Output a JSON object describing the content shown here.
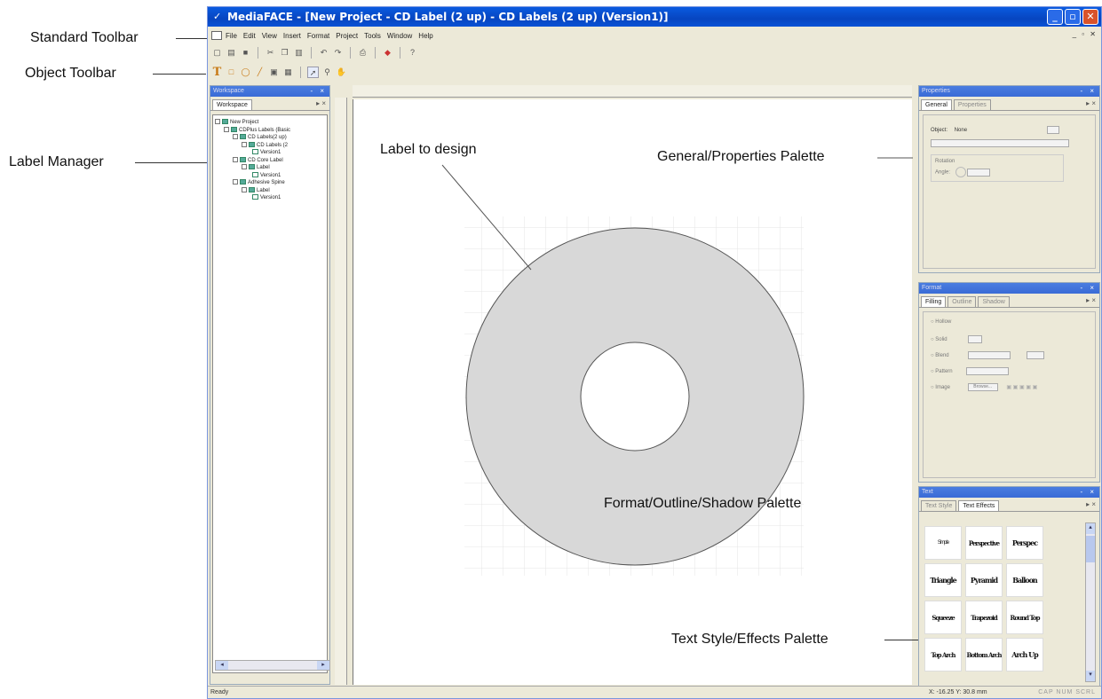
{
  "annotations": {
    "standard_toolbar": "Standard Toolbar",
    "object_toolbar": "Object Toolbar",
    "label_manager": "Label Manager",
    "label_to_design": "Label to design",
    "general_properties": "General/Properties Palette",
    "format_outline_shadow": "Format/Outline/Shadow Palette",
    "text_style_effects": "Text Style/Effects Palette"
  },
  "window": {
    "title": "MediaFACE - [New Project - CD Label (2 up) - CD Labels (2 up) (Version1)]"
  },
  "menu": [
    "File",
    "Edit",
    "View",
    "Insert",
    "Format",
    "Project",
    "Tools",
    "Window",
    "Help"
  ],
  "workspace": {
    "title": "Workspace",
    "tab": "Workspace",
    "tree": [
      "New Project",
      "CDPlus Labels (Basic",
      "CD Labels(2 up)",
      "CD Labels (2",
      "Version1",
      "CD Core Label",
      "Label",
      "Version1",
      "Adhesive Spine",
      "Label",
      "Version1"
    ]
  },
  "properties": {
    "title": "Properties",
    "tab_general": "General",
    "tab_properties": "Properties",
    "object_label": "Object:",
    "object_value": "None",
    "rotation_label": "Rotation",
    "angle_label": "Angle:"
  },
  "format": {
    "title": "Format",
    "tab_filling": "Filling",
    "tab_outline": "Outline",
    "tab_shadow": "Shadow",
    "options": [
      "Hollow",
      "Solid",
      "Blend",
      "Pattern",
      "Image"
    ],
    "browse_label": "Browse..."
  },
  "text": {
    "title": "Text",
    "tab_style": "Text Style",
    "tab_effects": "Text Effects",
    "effects": [
      "Simple",
      "Perspective",
      "Perspec",
      "Triangle",
      "Pyramid",
      "Balloon",
      "Squeeze",
      "Trapezoid",
      "Round Top",
      "Top Arch",
      "Bottom Arch",
      "Arch Up"
    ]
  },
  "status": {
    "left": "Ready",
    "coords": "X: -16.25 Y: 30.8  mm",
    "caps": "CAP  NUM  SCRL"
  },
  "colors": {
    "disc_fill": "#d8d8d8",
    "title_bar": "#0a5be0"
  }
}
